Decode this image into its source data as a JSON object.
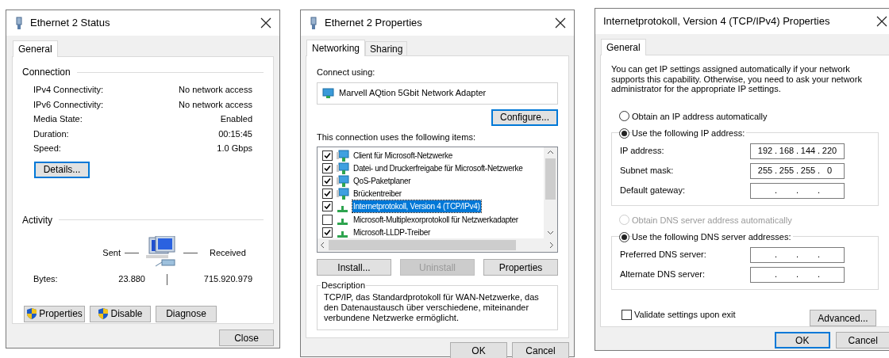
{
  "status_window": {
    "title": "Ethernet 2 Status",
    "tabs": [
      {
        "label": "General",
        "selected": true
      }
    ],
    "connection": {
      "heading": "Connection",
      "rows": [
        {
          "label": "IPv4 Connectivity:",
          "value": "No network access"
        },
        {
          "label": "IPv6 Connectivity:",
          "value": "No network access"
        },
        {
          "label": "Media State:",
          "value": "Enabled"
        },
        {
          "label": "Duration:",
          "value": "00:15:45"
        },
        {
          "label": "Speed:",
          "value": "1.0 Gbps"
        }
      ]
    },
    "details_button": {
      "label": "Details...",
      "default": true
    },
    "activity": {
      "heading": "Activity",
      "sent_label": "Sent",
      "received_label": "Received",
      "bytes_label": "Bytes:",
      "sent_bytes": "23.880",
      "received_bytes": "715.920.979"
    },
    "action_buttons": [
      {
        "label": "Properties",
        "shield": true
      },
      {
        "label": "Disable",
        "shield": true
      },
      {
        "label": "Diagnose",
        "shield": false
      }
    ],
    "close_button": {
      "label": "Close",
      "default": false
    }
  },
  "properties_window": {
    "title": "Ethernet 2 Properties",
    "tabs": [
      {
        "label": "Networking",
        "selected": true
      },
      {
        "label": "Sharing",
        "selected": false
      }
    ],
    "connect_using_label": "Connect using:",
    "adapter": "Marvell AQtion 5Gbit Network Adapter",
    "configure_button": {
      "label": "Configure...",
      "default": true
    },
    "items_label": "This connection uses the following items:",
    "items": [
      {
        "label": "Client für Microsoft-Netzwerke",
        "checked": true,
        "selected": false,
        "kind": "service"
      },
      {
        "label": "Datei- und Druckerfreigabe für Microsoft-Netzwerke",
        "checked": true,
        "selected": false,
        "kind": "service"
      },
      {
        "label": "QoS-Paketplaner",
        "checked": true,
        "selected": false,
        "kind": "service"
      },
      {
        "label": "Brückentreiber",
        "checked": true,
        "selected": false,
        "kind": "service"
      },
      {
        "label": "Internetprotokoll, Version 4 (TCP/IPv4)",
        "checked": true,
        "selected": true,
        "kind": "protocol"
      },
      {
        "label": "Microsoft-Multiplexorprotokoll für Netzwerkadapter",
        "checked": false,
        "selected": false,
        "kind": "protocol"
      },
      {
        "label": "Microsoft-LLDP-Treiber",
        "checked": true,
        "selected": false,
        "kind": "protocol"
      }
    ],
    "item_buttons": [
      {
        "label": "Install...",
        "disabled": false
      },
      {
        "label": "Uninstall",
        "disabled": true
      },
      {
        "label": "Properties",
        "disabled": false
      }
    ],
    "description": {
      "heading": "Description",
      "text": "TCP/IP, das Standardprotokoll für WAN-Netzwerke, das den Datenaustausch über verschiedene, miteinander verbundene Netzwerke ermöglicht."
    },
    "footer_buttons": [
      {
        "label": "OK",
        "default": false
      },
      {
        "label": "Cancel",
        "default": false
      }
    ]
  },
  "ipv4_window": {
    "title": "Internetprotokoll, Version 4 (TCP/IPv4) Properties",
    "tabs": [
      {
        "label": "General",
        "selected": true
      }
    ],
    "intro": "You can get IP settings assigned automatically if your network supports this capability. Otherwise, you need to ask your network administrator for the appropriate IP settings.",
    "octet_separator": ".",
    "ip_options": [
      {
        "label": "Obtain an IP address automatically",
        "selected": false,
        "disabled": false
      },
      {
        "label": "Use the following IP address:",
        "selected": true,
        "disabled": false
      }
    ],
    "ip_fields": [
      {
        "label": "IP address:",
        "octets": [
          "192",
          "168",
          "144",
          "220"
        ]
      },
      {
        "label": "Subnet mask:",
        "octets": [
          "255",
          "255",
          "255",
          "0"
        ]
      },
      {
        "label": "Default gateway:"
      }
    ],
    "dns_options": [
      {
        "label": "Obtain DNS server address automatically",
        "selected": false,
        "disabled": true
      },
      {
        "label": "Use the following DNS server addresses:",
        "selected": true,
        "disabled": false
      }
    ],
    "dns_fields": [
      {
        "label": "Preferred DNS server:"
      },
      {
        "label": "Alternate DNS server:"
      }
    ],
    "validate": {
      "label": "Validate settings upon exit",
      "checked": false
    },
    "advanced_button": {
      "label": "Advanced...",
      "default": false
    },
    "footer_buttons": [
      {
        "label": "OK",
        "default": true
      },
      {
        "label": "Cancel",
        "default": false
      }
    ]
  }
}
